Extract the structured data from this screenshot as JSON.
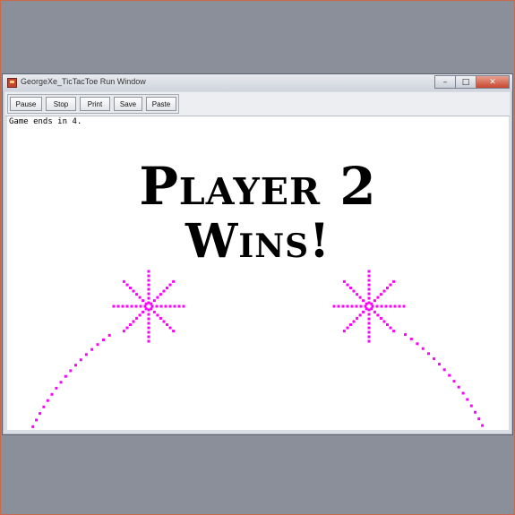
{
  "window": {
    "title": "GeorgeXe_TicTacToe Run Window",
    "controls": {
      "minimize": "–",
      "maximize": "□",
      "close": "✕"
    }
  },
  "toolbar": {
    "pause": "Pause",
    "stop": "Stop",
    "print": "Print",
    "save": "Save",
    "paste": "Paste"
  },
  "canvas": {
    "status": "Game ends in 4.",
    "result_line1": "Player 2",
    "result_line2": "Wins!"
  },
  "colors": {
    "sparkle": "#ff00ff",
    "background": "#ffffff",
    "text": "#000000"
  },
  "icons": [
    "app-icon",
    "minimize-icon",
    "maximize-icon",
    "close-icon",
    "sparkle-icon"
  ]
}
